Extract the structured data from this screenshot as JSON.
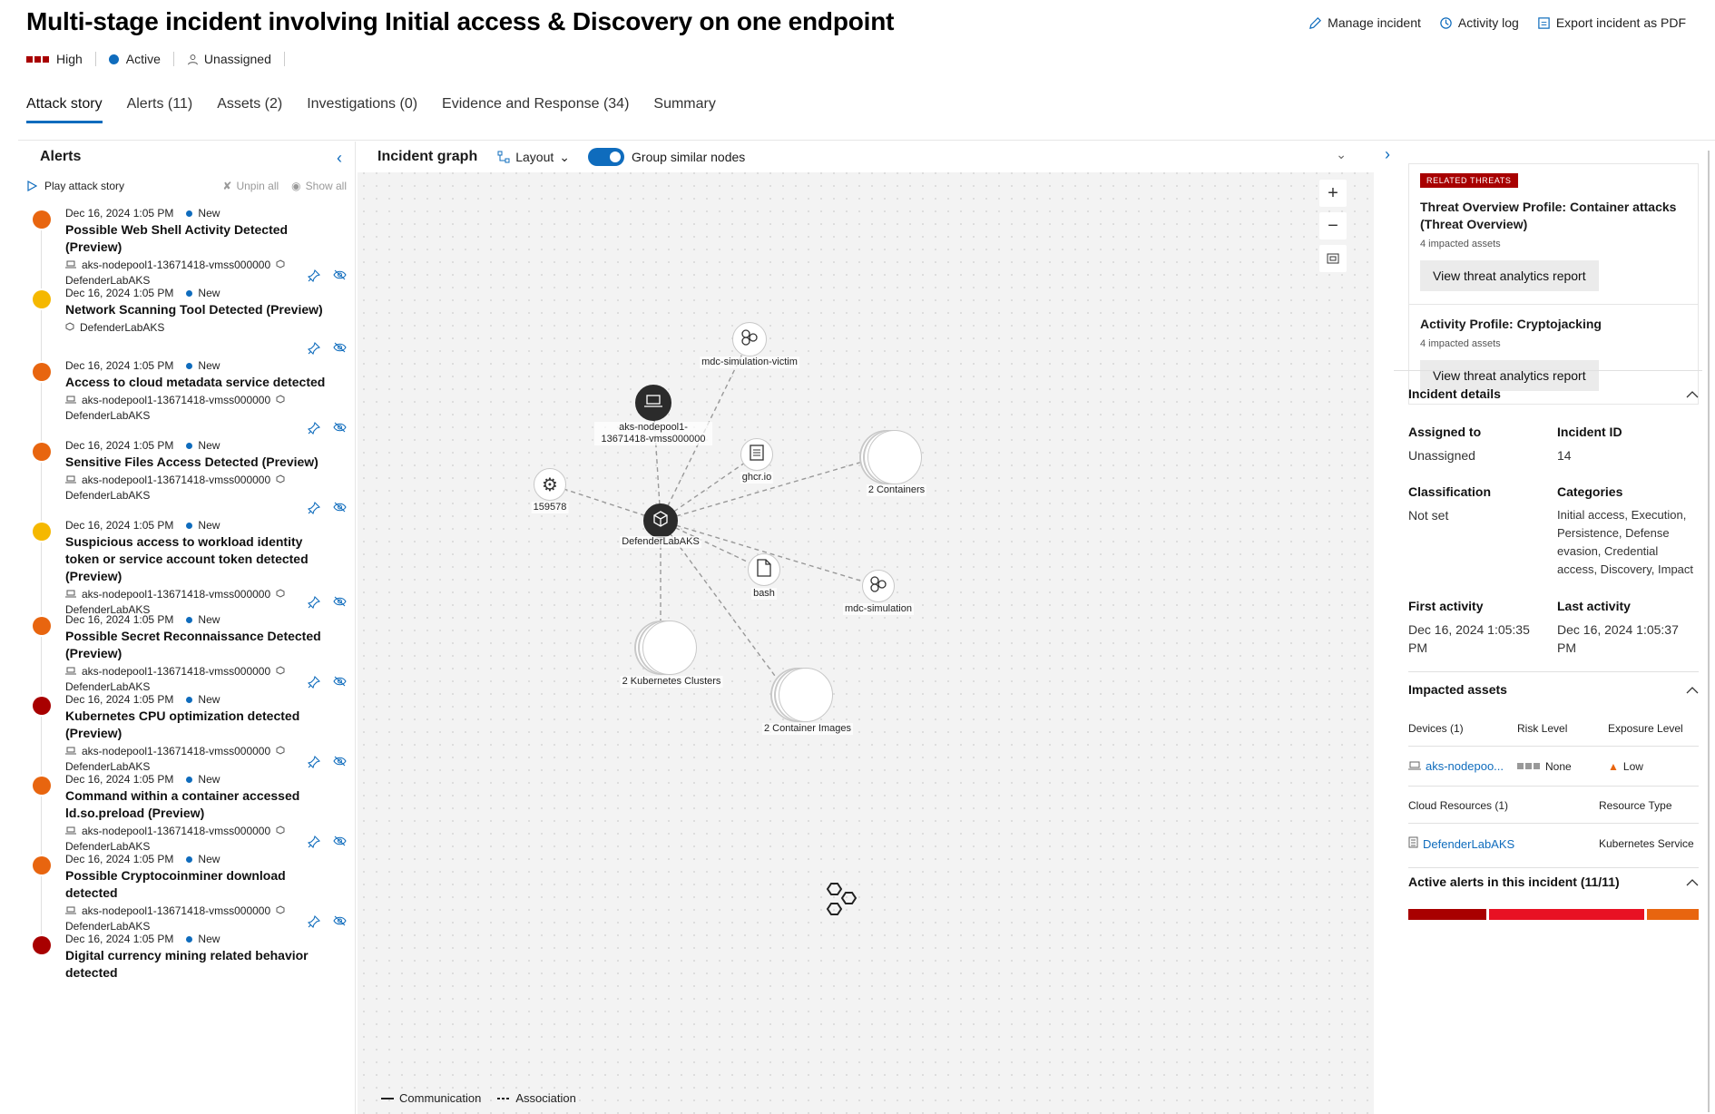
{
  "title": "Multi-stage incident involving Initial access & Discovery on one endpoint",
  "actions": {
    "manage": "Manage incident",
    "activity_log": "Activity log",
    "export": "Export incident as PDF"
  },
  "meta": {
    "severity": "High",
    "status": "Active",
    "assignee": "Unassigned"
  },
  "tabs": [
    "Attack story",
    "Alerts (11)",
    "Assets (2)",
    "Investigations (0)",
    "Evidence and Response (34)",
    "Summary"
  ],
  "alerts_panel": {
    "title": "Alerts",
    "play": "Play attack story",
    "unpin_all": "Unpin all",
    "show_all": "Show all",
    "items": [
      {
        "when": "Dec 16, 2024 1:05 PM",
        "status": "New",
        "name": "Possible Web Shell Activity Detected (Preview)",
        "device": "aks-nodepool1-13671418-vmss000000",
        "cluster": "DefenderLabAKS",
        "color": "#e8650f"
      },
      {
        "when": "Dec 16, 2024 1:05 PM",
        "status": "New",
        "name": "Network Scanning Tool Detected (Preview)",
        "device": "",
        "cluster": "DefenderLabAKS",
        "color": "#f5b800"
      },
      {
        "when": "Dec 16, 2024 1:05 PM",
        "status": "New",
        "name": "Access to cloud metadata service detected",
        "device": "aks-nodepool1-13671418-vmss000000",
        "cluster": "DefenderLabAKS",
        "color": "#e8650f"
      },
      {
        "when": "Dec 16, 2024 1:05 PM",
        "status": "New",
        "name": "Sensitive Files Access Detected (Preview)",
        "device": "aks-nodepool1-13671418-vmss000000",
        "cluster": "DefenderLabAKS",
        "color": "#e8650f"
      },
      {
        "when": "Dec 16, 2024 1:05 PM",
        "status": "New",
        "name": "Suspicious access to workload identity token or service account token detected (Preview)",
        "device": "aks-nodepool1-13671418-vmss000000",
        "cluster": "DefenderLabAKS",
        "color": "#f5b800"
      },
      {
        "when": "Dec 16, 2024 1:05 PM",
        "status": "New",
        "name": "Possible Secret Reconnaissance Detected (Preview)",
        "device": "aks-nodepool1-13671418-vmss000000",
        "cluster": "DefenderLabAKS",
        "color": "#e8650f"
      },
      {
        "when": "Dec 16, 2024 1:05 PM",
        "status": "New",
        "name": "Kubernetes CPU optimization detected (Preview)",
        "device": "aks-nodepool1-13671418-vmss000000",
        "cluster": "DefenderLabAKS",
        "color": "#a80000"
      },
      {
        "when": "Dec 16, 2024 1:05 PM",
        "status": "New",
        "name": "Command within a container accessed ld.so.preload (Preview)",
        "device": "aks-nodepool1-13671418-vmss000000",
        "cluster": "DefenderLabAKS",
        "color": "#e8650f"
      },
      {
        "when": "Dec 16, 2024 1:05 PM",
        "status": "New",
        "name": "Possible Cryptocoinminer download detected",
        "device": "aks-nodepool1-13671418-vmss000000",
        "cluster": "DefenderLabAKS",
        "color": "#e8650f"
      },
      {
        "when": "Dec 16, 2024 1:05 PM",
        "status": "New",
        "name": "Digital currency mining related behavior detected",
        "device": "",
        "cluster": "",
        "color": "#a80000"
      }
    ]
  },
  "graph": {
    "title": "Incident graph",
    "layout": "Layout",
    "group_similar": "Group similar nodes",
    "legend": {
      "communication": "Communication",
      "association": "Association"
    },
    "nodes": {
      "victim": "mdc-simulation-victim",
      "device": "aks-nodepool1-13671418-vmss000000",
      "ghcr": "ghcr.io",
      "containers": "2 Containers",
      "process": "159578",
      "cluster": "DefenderLabAKS",
      "bash": "bash",
      "simulation": "mdc-simulation",
      "k8s": "2 Kubernetes Clusters",
      "images": "2 Container Images"
    }
  },
  "right_panel": {
    "badge": "RELATED THREATS",
    "threats": [
      {
        "title": "Threat Overview Profile: Container attacks (Threat Overview)",
        "impacted": "4 impacted assets",
        "button": "View threat analytics report"
      },
      {
        "title": "Activity Profile: Cryptojacking",
        "impacted": "4 impacted assets",
        "button": "View threat analytics report"
      }
    ],
    "details": {
      "title": "Incident details",
      "assigned_to_k": "Assigned to",
      "assigned_to_v": "Unassigned",
      "incident_id_k": "Incident ID",
      "incident_id_v": "14",
      "classification_k": "Classification",
      "classification_v": "Not set",
      "categories_k": "Categories",
      "categories_v": "Initial access, Execution, Persistence, Defense evasion, Credential access, Discovery, Impact",
      "first_k": "First activity",
      "first_v": "Dec 16, 2024 1:05:35 PM",
      "last_k": "Last activity",
      "last_v": "Dec 16, 2024 1:05:37 PM"
    },
    "assets": {
      "title": "Impacted assets",
      "devices_h": "Devices (1)",
      "risk_h": "Risk Level",
      "exposure_h": "Exposure Level",
      "device": "aks-nodepoo...",
      "risk": "None",
      "exposure": "Low",
      "cloud_h": "Cloud Resources (1)",
      "type_h": "Resource Type",
      "cloud": "DefenderLabAKS",
      "type": "Kubernetes Service"
    },
    "active_alerts": {
      "title": "Active alerts in this incident (11/11)"
    }
  }
}
